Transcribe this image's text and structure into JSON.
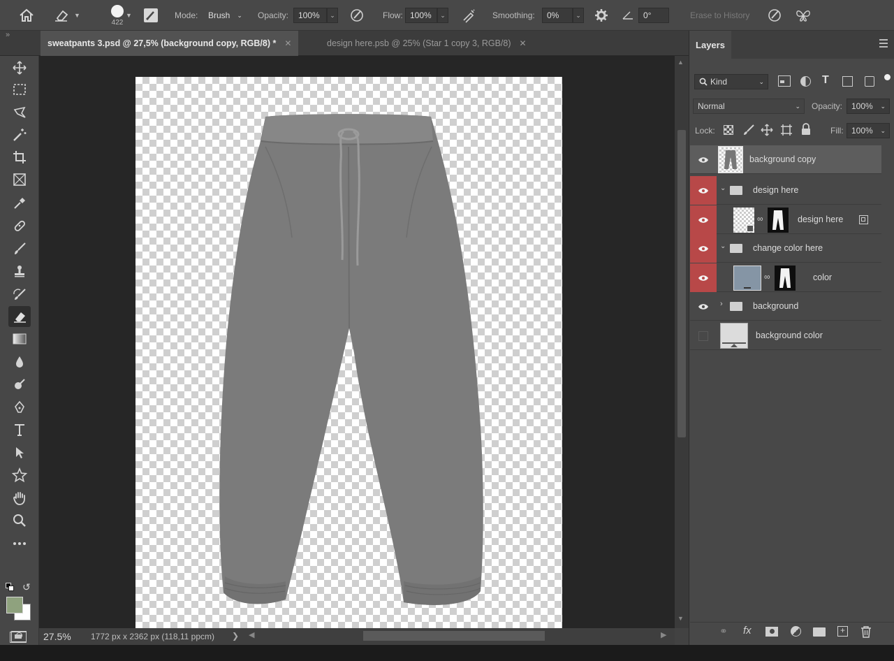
{
  "options_bar": {
    "brush_size": "422",
    "mode_label": "Mode:",
    "mode_value": "Brush",
    "opacity_label": "Opacity:",
    "opacity_value": "100%",
    "flow_label": "Flow:",
    "flow_value": "100%",
    "smoothing_label": "Smoothing:",
    "smoothing_value": "0%",
    "angle_value": "0°",
    "erase_to_history": "Erase to History"
  },
  "tabs": [
    {
      "label": "sweatpants 3.psd @ 27,5% (background copy, RGB/8) *",
      "active": true
    },
    {
      "label": "design here.psb @ 25% (Star 1 copy 3, RGB/8)",
      "active": false
    }
  ],
  "collapse_glyph": "»",
  "status": {
    "zoom": "27.5%",
    "doc_info": "1772 px x 2362 px (118,11 ppcm)"
  },
  "layers_panel": {
    "title": "Layers",
    "filter_kind": "Kind",
    "blend_mode": "Normal",
    "opacity_label": "Opacity:",
    "opacity_value": "100%",
    "lock_label": "Lock:",
    "fill_label": "Fill:",
    "fill_value": "100%",
    "layers": [
      {
        "name": "background copy",
        "visible": true,
        "highlighted": false,
        "selected": true,
        "type": "pixel"
      },
      {
        "name": "design here",
        "visible": true,
        "highlighted": true,
        "selected": false,
        "type": "group-open"
      },
      {
        "name": "design here",
        "visible": true,
        "highlighted": true,
        "selected": false,
        "type": "smart-with-mask"
      },
      {
        "name": "change color here",
        "visible": true,
        "highlighted": true,
        "selected": false,
        "type": "group-open"
      },
      {
        "name": "color",
        "visible": true,
        "highlighted": true,
        "selected": false,
        "type": "fill-with-mask"
      },
      {
        "name": "background",
        "visible": true,
        "highlighted": false,
        "selected": false,
        "type": "group-closed"
      },
      {
        "name": "background color",
        "visible": false,
        "highlighted": false,
        "selected": false,
        "type": "fill"
      }
    ]
  },
  "colors": {
    "foreground": "#8fa27e",
    "background": "#ffffff",
    "highlight_red": "#b84848",
    "garment_gray": "#7b7b7b"
  }
}
